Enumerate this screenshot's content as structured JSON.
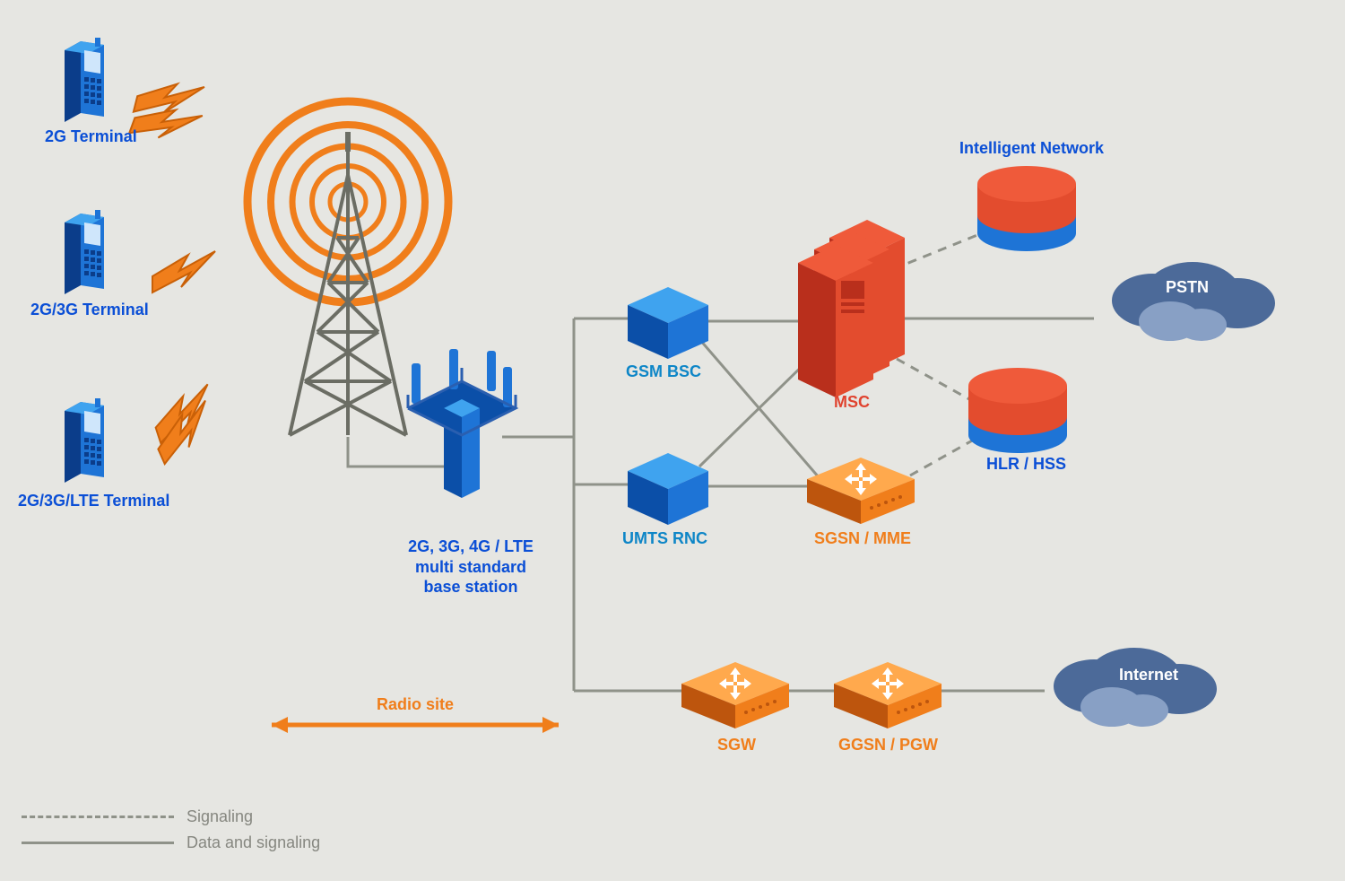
{
  "nodes": {
    "terminal2g": {
      "label": "2G Terminal"
    },
    "terminal2g3g": {
      "label": "2G/3G Terminal"
    },
    "terminal2g3glte": {
      "label": "2G/3G/LTE Terminal"
    },
    "basestation": {
      "label_line1": "2G, 3G, 4G / LTE",
      "label_line2": "multi standard",
      "label_line3": "base station"
    },
    "radiosite": {
      "label": "Radio site"
    },
    "gsmbsc": {
      "label": "GSM BSC"
    },
    "umtsrnc": {
      "label": "UMTS RNC"
    },
    "msc": {
      "label": "MSC"
    },
    "sgsnmme": {
      "label": "SGSN / MME"
    },
    "sgw": {
      "label": "SGW"
    },
    "ggsn_pgw": {
      "label": "GGSN / PGW"
    },
    "intelligentnetwork": {
      "label": "Intelligent Network"
    },
    "hlrhss": {
      "label": "HLR / HSS"
    },
    "pstn": {
      "label": "PSTN"
    },
    "internet": {
      "label": "Internet"
    }
  },
  "legend": {
    "signaling": "Signaling",
    "both": "Data and signaling"
  },
  "colors": {
    "bg": "#e6e6e2",
    "blueShape": "#1e74d6",
    "blueFace": "#3fa3ef",
    "blueDark": "#0b3d8a",
    "router": "#f07e1b",
    "routerTop": "#ffa94d",
    "routerDark": "#bd550d",
    "red": "#e34c2e",
    "redDark": "#b92f1c",
    "redBright": "#ef5a3a",
    "line": "#8f9289",
    "dash": "#8f9289",
    "cloud": "#4c6a99",
    "cloudLight": "#88a0c5",
    "antennaOrange": "#f07e1b"
  }
}
